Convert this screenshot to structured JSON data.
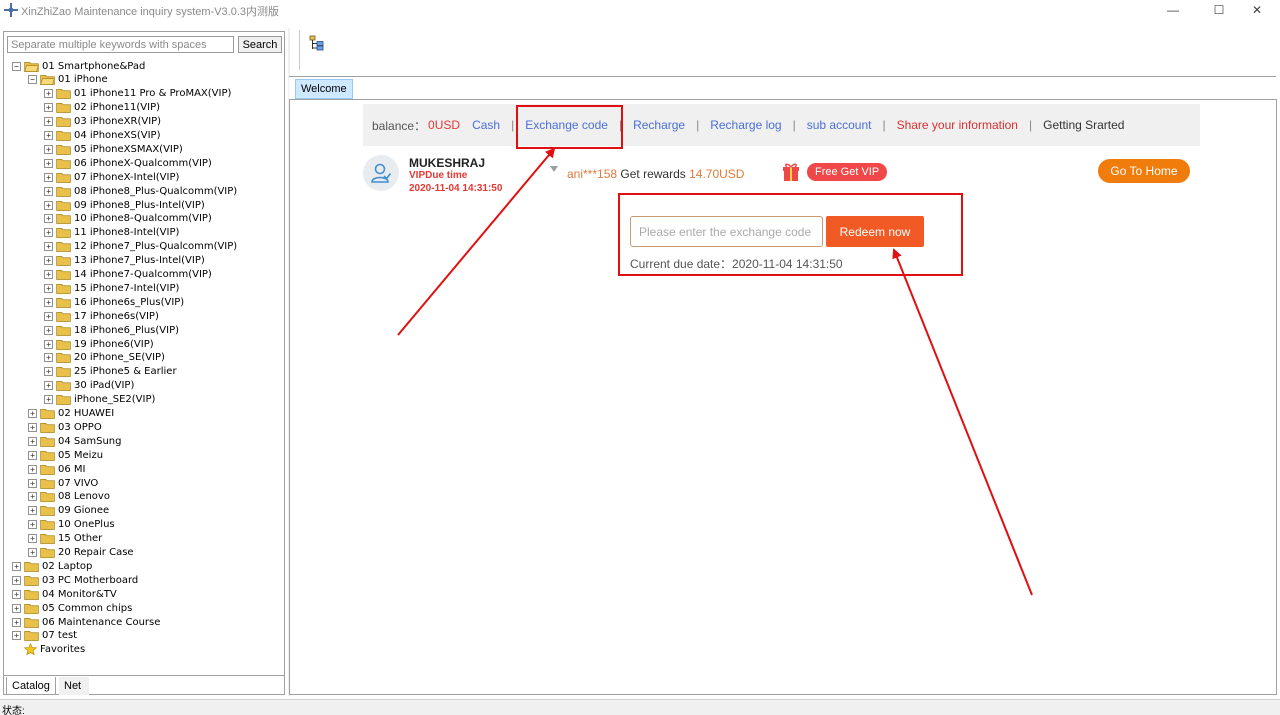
{
  "window": {
    "title": "XinZhiZao Maintenance inquiry system-V3.0.3内测版",
    "minimize_glyph": "—",
    "maximize_glyph": "☐",
    "close_glyph": "✕"
  },
  "search": {
    "placeholder": "Separate multiple keywords with spaces",
    "button_label": "Search"
  },
  "tree": [
    {
      "label": "01 Smartphone&Pad",
      "level": 0,
      "expander": "−",
      "icon": "folder-open-icon"
    },
    {
      "label": "01 iPhone",
      "level": 1,
      "expander": "−",
      "icon": "folder-open-icon"
    },
    {
      "label": "01 iPhone11 Pro & ProMAX(VIP)",
      "level": 2,
      "expander": "+",
      "icon": "folder-icon"
    },
    {
      "label": "02 iPhone11(VIP)",
      "level": 2,
      "expander": "+",
      "icon": "folder-icon"
    },
    {
      "label": "03 iPhoneXR(VIP)",
      "level": 2,
      "expander": "+",
      "icon": "folder-icon"
    },
    {
      "label": "04 iPhoneXS(VIP)",
      "level": 2,
      "expander": "+",
      "icon": "folder-icon"
    },
    {
      "label": "05 iPhoneXSMAX(VIP)",
      "level": 2,
      "expander": "+",
      "icon": "folder-icon"
    },
    {
      "label": "06 iPhoneX-Qualcomm(VIP)",
      "level": 2,
      "expander": "+",
      "icon": "folder-icon"
    },
    {
      "label": "07 iPhoneX-Intel(VIP)",
      "level": 2,
      "expander": "+",
      "icon": "folder-icon"
    },
    {
      "label": "08 iPhone8_Plus-Qualcomm(VIP)",
      "level": 2,
      "expander": "+",
      "icon": "folder-icon"
    },
    {
      "label": "09 iPhone8_Plus-Intel(VIP)",
      "level": 2,
      "expander": "+",
      "icon": "folder-icon"
    },
    {
      "label": "10 iPhone8-Qualcomm(VIP)",
      "level": 2,
      "expander": "+",
      "icon": "folder-icon"
    },
    {
      "label": "11 iPhone8-Intel(VIP)",
      "level": 2,
      "expander": "+",
      "icon": "folder-icon"
    },
    {
      "label": "12 iPhone7_Plus-Qualcomm(VIP)",
      "level": 2,
      "expander": "+",
      "icon": "folder-icon"
    },
    {
      "label": "13 iPhone7_Plus-Intel(VIP)",
      "level": 2,
      "expander": "+",
      "icon": "folder-icon"
    },
    {
      "label": "14 iPhone7-Qualcomm(VIP)",
      "level": 2,
      "expander": "+",
      "icon": "folder-icon"
    },
    {
      "label": "15 iPhone7-Intel(VIP)",
      "level": 2,
      "expander": "+",
      "icon": "folder-icon"
    },
    {
      "label": "16 iPhone6s_Plus(VIP)",
      "level": 2,
      "expander": "+",
      "icon": "folder-icon"
    },
    {
      "label": "17 iPhone6s(VIP)",
      "level": 2,
      "expander": "+",
      "icon": "folder-icon"
    },
    {
      "label": "18 iPhone6_Plus(VIP)",
      "level": 2,
      "expander": "+",
      "icon": "folder-icon"
    },
    {
      "label": "19 iPhone6(VIP)",
      "level": 2,
      "expander": "+",
      "icon": "folder-icon"
    },
    {
      "label": "20 iPhone_SE(VIP)",
      "level": 2,
      "expander": "+",
      "icon": "folder-icon"
    },
    {
      "label": "25 iPhone5 & Earlier",
      "level": 2,
      "expander": "+",
      "icon": "folder-icon"
    },
    {
      "label": "30 iPad(VIP)",
      "level": 2,
      "expander": "+",
      "icon": "folder-icon"
    },
    {
      "label": "iPhone_SE2(VIP)",
      "level": 2,
      "expander": "+",
      "icon": "folder-icon"
    },
    {
      "label": "02 HUAWEI",
      "level": 1,
      "expander": "+",
      "icon": "folder-icon"
    },
    {
      "label": "03 OPPO",
      "level": 1,
      "expander": "+",
      "icon": "folder-icon"
    },
    {
      "label": "04 SamSung",
      "level": 1,
      "expander": "+",
      "icon": "folder-icon"
    },
    {
      "label": "05 Meizu",
      "level": 1,
      "expander": "+",
      "icon": "folder-icon"
    },
    {
      "label": "06 MI",
      "level": 1,
      "expander": "+",
      "icon": "folder-icon"
    },
    {
      "label": "07 VIVO",
      "level": 1,
      "expander": "+",
      "icon": "folder-icon"
    },
    {
      "label": "08 Lenovo",
      "level": 1,
      "expander": "+",
      "icon": "folder-icon"
    },
    {
      "label": "09 Gionee",
      "level": 1,
      "expander": "+",
      "icon": "folder-icon"
    },
    {
      "label": "10 OnePlus",
      "level": 1,
      "expander": "+",
      "icon": "folder-icon"
    },
    {
      "label": "15 Other",
      "level": 1,
      "expander": "+",
      "icon": "folder-icon"
    },
    {
      "label": "20 Repair Case",
      "level": 1,
      "expander": "+",
      "icon": "folder-icon"
    },
    {
      "label": "02 Laptop",
      "level": 0,
      "expander": "+",
      "icon": "folder-icon"
    },
    {
      "label": "03 PC Motherboard",
      "level": 0,
      "expander": "+",
      "icon": "folder-icon"
    },
    {
      "label": "04 Monitor&TV",
      "level": 0,
      "expander": "+",
      "icon": "folder-icon"
    },
    {
      "label": "05 Common chips",
      "level": 0,
      "expander": "+",
      "icon": "folder-icon"
    },
    {
      "label": "06 Maintenance Course",
      "level": 0,
      "expander": "+",
      "icon": "folder-icon"
    },
    {
      "label": "07 test",
      "level": 0,
      "expander": "+",
      "icon": "folder-icon"
    },
    {
      "label": "Favorites",
      "level": 0,
      "expander": "",
      "icon": "star-icon"
    }
  ],
  "bottom_tabs": {
    "catalog": "Catalog",
    "net": "Net"
  },
  "tabs": {
    "welcome": "Welcome"
  },
  "nav": {
    "balance_label": "balance：",
    "balance_value": "0USD",
    "cash": "Cash",
    "exchange_code": "Exchange code",
    "recharge": "Recharge",
    "recharge_log": "Recharge log",
    "sub_account": "sub account",
    "share_info": "Share your information",
    "getting_started": "Getting Srarted",
    "separator": "|"
  },
  "user": {
    "name": "MUKESHRAJ",
    "vip_due_label": "VIPDue time",
    "vip_due_date": "2020-11-04 14:31:50"
  },
  "reward": {
    "user": "ani***158",
    "text": "Get rewards",
    "amount": "14.70USD"
  },
  "free_vip_label": "Free Get VIP",
  "go_home_label": "Go To Home",
  "exchange": {
    "placeholder": "Please enter the exchange code",
    "redeem_label": "Redeem now",
    "due_line": "Current due date：2020-11-04 14:31:50"
  },
  "status": {
    "label": "状态:"
  },
  "colors": {
    "accent_link": "#4a6fd8",
    "warning_red": "#e53935",
    "redeem_orange": "#f15a24",
    "home_orange": "#f07c0c",
    "annotation_red": "#e01010"
  }
}
